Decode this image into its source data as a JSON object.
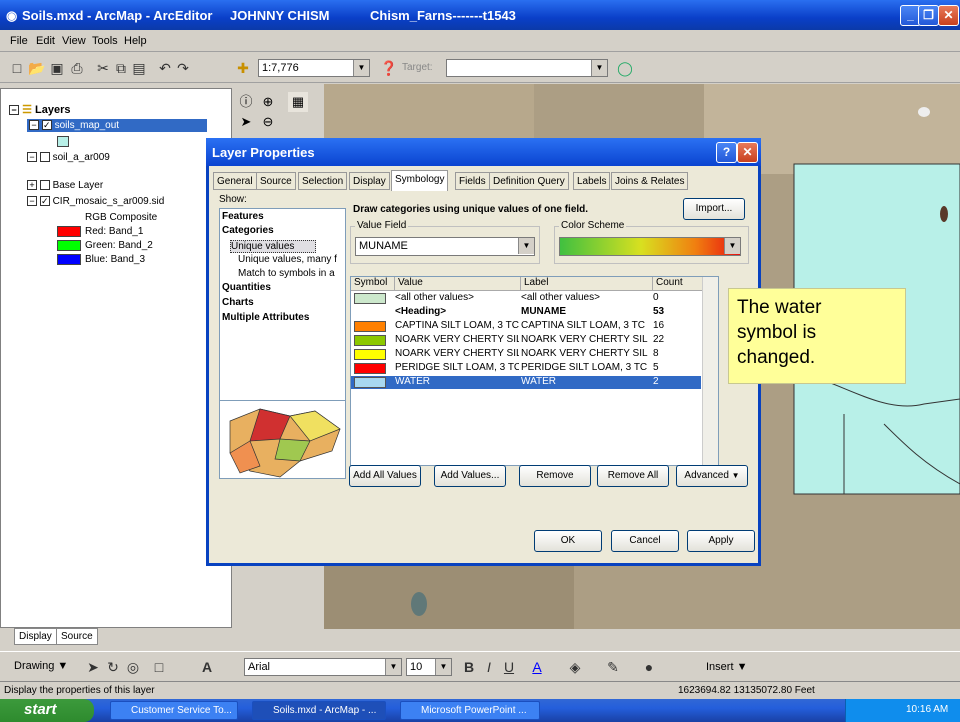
{
  "window": {
    "title": "Soils.mxd - ArcMap - ArcEditor",
    "user": "JOHNNY CHISM",
    "session": "Chism_Farns-------t1543"
  },
  "menu": [
    "File",
    "Edit",
    "View",
    "Tools",
    "Help"
  ],
  "toolbar": {
    "scale": "1:7,776",
    "target_label": "Target:"
  },
  "toc": {
    "root": "Layers",
    "layers": [
      {
        "name": "soils_map_out",
        "checked": true,
        "selected": true
      },
      {
        "name": "soil_a_ar009",
        "checked": false
      },
      {
        "name": "Base Layer",
        "checked": false
      },
      {
        "name": "CIR_mosaic_s_ar009.sid",
        "checked": true
      }
    ],
    "rgb_composite": "RGB Composite",
    "bands": [
      {
        "label": "Red:",
        "band": "Band_1",
        "color": "#ff0000"
      },
      {
        "label": "Green:",
        "band": "Band_2",
        "color": "#00ff00"
      },
      {
        "label": "Blue:",
        "band": "Band_3",
        "color": "#0000ff"
      }
    ]
  },
  "bottom_tabs": [
    "Display",
    "Source"
  ],
  "drawing_toolbar": {
    "drawing_label": "Drawing",
    "font": "Arial",
    "size": "10",
    "insert_label": "Insert"
  },
  "status": {
    "message": "Display the properties of this layer",
    "coords": "1623694.82  13135072.80 Feet"
  },
  "taskbar": {
    "start": "start",
    "tasks": [
      "Customer Service To...",
      "Soils.mxd - ArcMap - ...",
      "Microsoft PowerPoint ..."
    ],
    "clock": "10:16 AM"
  },
  "dialog": {
    "title": "Layer Properties",
    "tabs": [
      "General",
      "Source",
      "Selection",
      "Display",
      "Symbology",
      "Fields",
      "Definition Query",
      "Labels",
      "Joins & Relates"
    ],
    "active_tab": "Symbology",
    "show_label": "Show:",
    "show_items": [
      "Features",
      "Categories",
      "Unique values",
      "Unique values, many f",
      "Match to symbols in a",
      "Quantities",
      "Charts",
      "Multiple Attributes"
    ],
    "heading": "Draw categories using unique values of one field.",
    "import_button": "Import...",
    "value_field_label": "Value Field",
    "value_field": "MUNAME",
    "color_scheme_label": "Color Scheme",
    "columns": [
      "Symbol",
      "Value",
      "Label",
      "Count"
    ],
    "rows": [
      {
        "value": "<all other values>",
        "label": "<all other values>",
        "count": "0",
        "color": "#cce8cc",
        "bold": false
      },
      {
        "value": "<Heading>",
        "label": "MUNAME",
        "count": "53",
        "color": "",
        "bold": true
      },
      {
        "value": "CAPTINA SILT LOAM, 3 TC",
        "label": "CAPTINA SILT LOAM, 3 TC",
        "count": "16",
        "color": "#ff8000",
        "bold": false
      },
      {
        "value": "NOARK VERY CHERTY SIL",
        "label": "NOARK VERY CHERTY SIL",
        "count": "22",
        "color": "#8cc800",
        "bold": false
      },
      {
        "value": "NOARK VERY CHERTY SIL",
        "label": "NOARK VERY CHERTY SIL",
        "count": "8",
        "color": "#ffff00",
        "bold": false
      },
      {
        "value": "PERIDGE SILT LOAM, 3 TC",
        "label": "PERIDGE SILT LOAM, 3 TC",
        "count": "5",
        "color": "#ff0000",
        "bold": false
      },
      {
        "value": "WATER",
        "label": "WATER",
        "count": "2",
        "color": "#a8d8f0",
        "bold": false,
        "selected": true
      }
    ],
    "buttons": {
      "add_all": "Add All Values",
      "add": "Add Values...",
      "remove": "Remove",
      "remove_all": "Remove All",
      "advanced": "Advanced"
    },
    "footer": {
      "ok": "OK",
      "cancel": "Cancel",
      "apply": "Apply"
    }
  },
  "callout": [
    "The water",
    "symbol is",
    "changed."
  ]
}
